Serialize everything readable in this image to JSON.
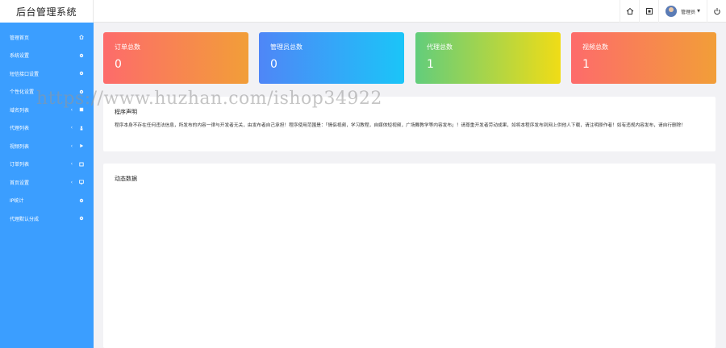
{
  "header": {
    "title": "后台管理系统",
    "user_name": "管理员",
    "icons": [
      "home-icon",
      "screenshot-icon",
      "power-icon"
    ]
  },
  "sidebar": {
    "items": [
      {
        "label": "管理首页",
        "icon": "home-icon",
        "has_arrow": false
      },
      {
        "label": "系统设置",
        "icon": "gear-icon",
        "has_arrow": false
      },
      {
        "label": "短信接口设置",
        "icon": "gear-icon",
        "has_arrow": false
      },
      {
        "label": "个性化设置",
        "icon": "gear-icon",
        "has_arrow": false
      },
      {
        "label": "域名列表",
        "icon": "list-icon",
        "has_arrow": true
      },
      {
        "label": "代理列表",
        "icon": "user-icon",
        "has_arrow": true
      },
      {
        "label": "视频列表",
        "icon": "play-icon",
        "has_arrow": true
      },
      {
        "label": "订单列表",
        "icon": "order-icon",
        "has_arrow": true
      },
      {
        "label": "首页设置",
        "icon": "monitor-icon",
        "has_arrow": true
      },
      {
        "label": "IP统计",
        "icon": "gear-icon",
        "has_arrow": false
      },
      {
        "label": "代理默认分成",
        "icon": "gear-icon",
        "has_arrow": false
      }
    ]
  },
  "cards": [
    {
      "title": "订单总数",
      "value": "0"
    },
    {
      "title": "管理员总数",
      "value": "0"
    },
    {
      "title": "代理总数",
      "value": "1"
    },
    {
      "title": "视频总数",
      "value": "1"
    }
  ],
  "notice": {
    "title": "程序声明",
    "text": "程序本身不存在任何违法信息，所发布的内容一律与开发者无关，由发布者自己承担！程序使用范围是：「情侣视频，学习教程，自媒体短视频，广场舞教学等内容发布」！请尊重开发者劳动成果，如将本程序发布到网上供他人下载，请注明原作者！如有违规内容发布，请自行删除！"
  },
  "dynamic": {
    "title": "动态数据"
  },
  "watermark": "https://www.huzhan.com/ishop34922",
  "colors": {
    "sidebar": "#3b9eff",
    "card_red": [
      "#fd6b6b",
      "#f29e38"
    ],
    "card_blue": [
      "#4f86f7",
      "#1bc5f8"
    ],
    "card_green": [
      "#62cd7c",
      "#f0dc16"
    ]
  }
}
